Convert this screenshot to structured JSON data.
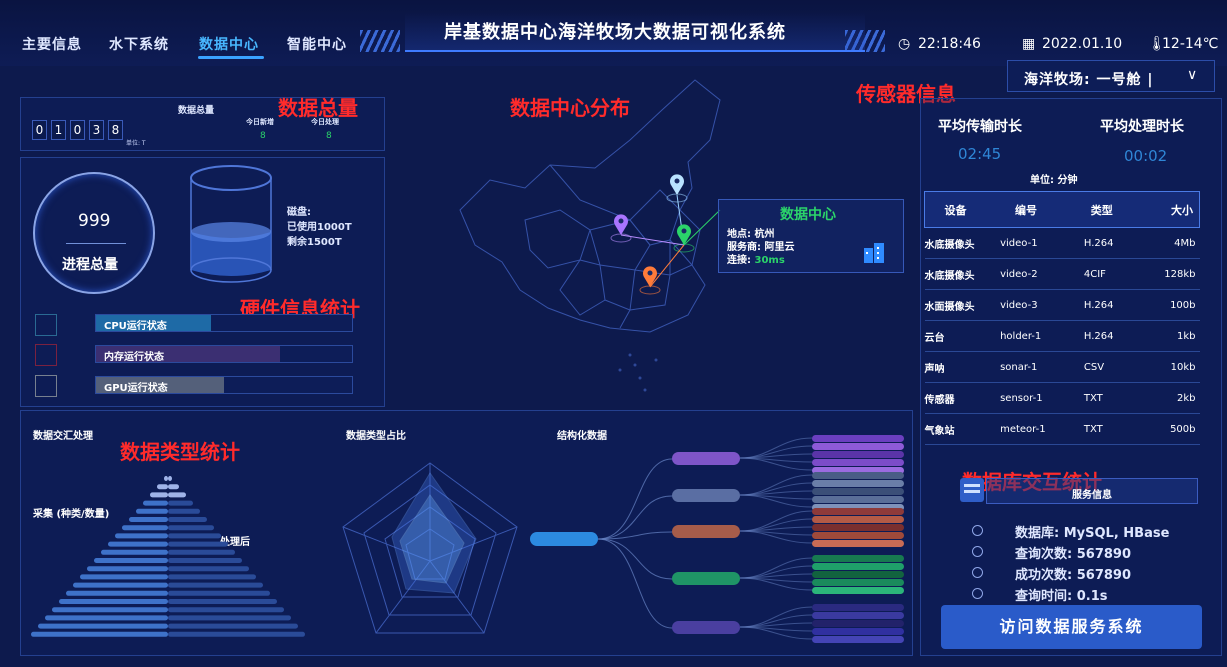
{
  "nav": {
    "items": [
      "主要信息",
      "水下系统",
      "数据中心",
      "智能中心"
    ],
    "active_index": 2
  },
  "title": "岸基数据中心海洋牧场大数据可视化系统",
  "topinfo": {
    "time": "22:18:46",
    "date": "2022.01.10",
    "temp": "12-14℃"
  },
  "farm_selector": {
    "label": "海洋牧场: 一号舱 |",
    "chevron": "chevron-down-icon"
  },
  "annotations": {
    "total": "数据总量",
    "center": "数据中心分布",
    "sensor": "传感器信息",
    "hardware": "硬件信息统计",
    "types": "数据类型统计",
    "db": "数据库交互统计"
  },
  "totals": {
    "title": "数据总量",
    "digits": [
      "0",
      "1",
      "0",
      "3",
      "8"
    ],
    "unit": "单位: T",
    "today_new_label": "今日新增",
    "today_new": "8",
    "today_proc_label": "今日处理",
    "today_proc": "8"
  },
  "hardware": {
    "process_count": "999",
    "process_label": "进程总量",
    "disk_title": "磁盘:",
    "disk_used": "已使用1000T",
    "disk_free": "剩余1500T",
    "bars": [
      {
        "label": "CPU运行状态",
        "fill": 0.45,
        "color": "#1e6aa6",
        "border": "#2a6a93"
      },
      {
        "label": "内存运行状态",
        "fill": 0.72,
        "color": "#3b2f72",
        "border": "#7a2140"
      },
      {
        "label": "GPU运行状态",
        "fill": 0.5,
        "color": "#54607a",
        "border": "#77808f"
      }
    ]
  },
  "map": {
    "info_title": "数据中心",
    "location_label": "地点:",
    "location": "杭州",
    "provider_label": "服务商:",
    "provider": "阿里云",
    "latency_label": "连接:",
    "latency": "30ms"
  },
  "sensor": {
    "avg_trans_label": "平均传输时长",
    "avg_trans": "02:45",
    "avg_proc_label": "平均处理时长",
    "avg_proc": "00:02",
    "unit": "单位: 分钟",
    "headers": [
      "设备",
      "编号",
      "类型",
      "大小"
    ],
    "rows": [
      [
        "水底摄像头",
        "video-1",
        "H.264",
        "4Mb"
      ],
      [
        "水底摄像头",
        "video-2",
        "4CIF",
        "128kb"
      ],
      [
        "水面摄像头",
        "video-3",
        "H.264",
        "100b"
      ],
      [
        "云台",
        "holder-1",
        "H.264",
        "1kb"
      ],
      [
        "声呐",
        "sonar-1",
        "CSV",
        "10kb"
      ],
      [
        "传感器",
        "sensor-1",
        "TXT",
        "2kb"
      ],
      [
        "气象站",
        "meteor-1",
        "TXT",
        "500b"
      ]
    ]
  },
  "db": {
    "service_label": "服务信息",
    "lines": [
      "数据库: MySQL, HBase",
      "查询次数: 567890",
      "成功次数: 567890",
      "查询时间: 0.1s"
    ],
    "button": "访问数据服务系统"
  },
  "types": {
    "agg_title": "数据交汇处理",
    "collect_label": "采集 (种类/数量)",
    "processed_label": "处理后",
    "ratio_title": "数据类型占比",
    "structured_title": "结构化数据",
    "tree_colors": [
      "#7e55c8",
      "#5a6ea3",
      "#a65c4a",
      "#1f9466",
      "#4a3fa0"
    ],
    "stack_colors": [
      [
        "#6b3fc0",
        "#8e5ad8",
        "#5a34a8",
        "#7b4cc9",
        "#9a6be0"
      ],
      [
        "#495d86",
        "#6a7ea8",
        "#3b4f78",
        "#5a6e98",
        "#7f92ba"
      ],
      [
        "#8e3a3a",
        "#b35a46",
        "#7a2f2f",
        "#a04a3a",
        "#c96b55"
      ],
      [
        "#177a50",
        "#1fa06a",
        "#12633f",
        "#1a8a5c",
        "#2bb57a"
      ],
      [
        "#2a2a80",
        "#3a3aa0",
        "#22226a",
        "#3030a0",
        "#4444b5"
      ]
    ]
  }
}
